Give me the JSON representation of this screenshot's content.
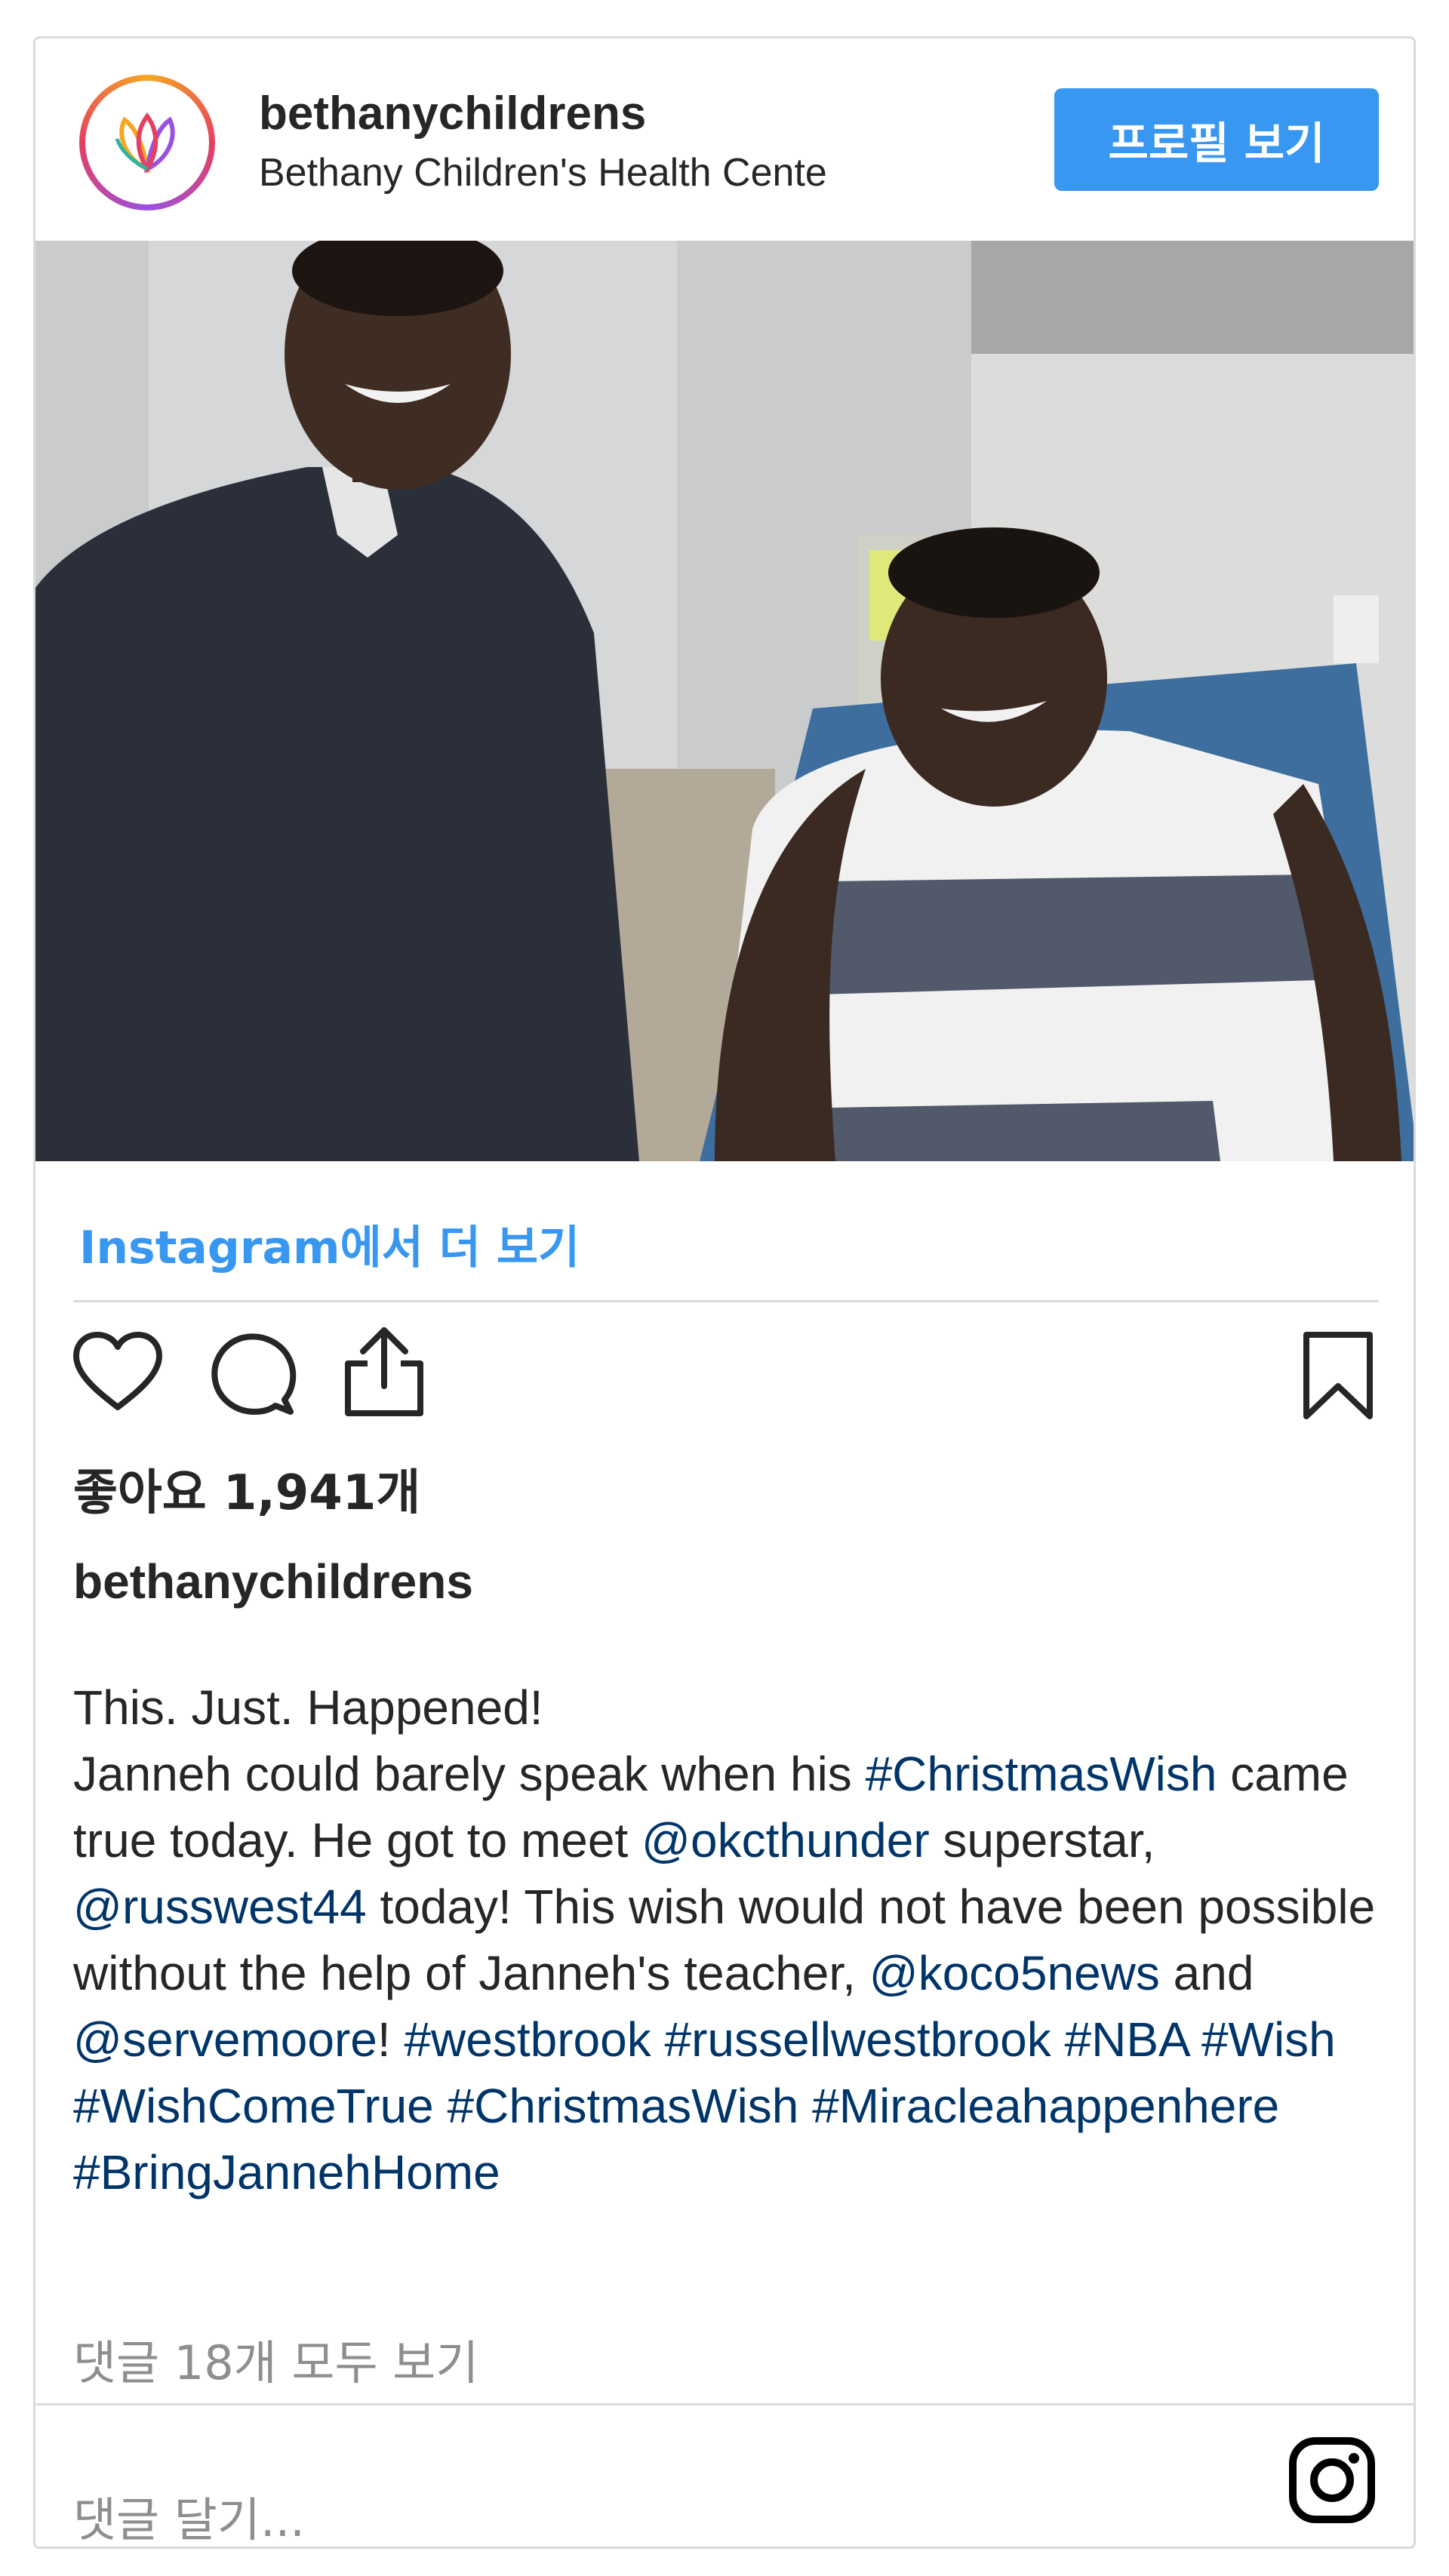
{
  "header": {
    "username": "bethanychildrens",
    "full_name": "Bethany Children's Health Cente",
    "profile_button": "프로필 보기"
  },
  "photo": {
    "icon": "post-photo"
  },
  "see_more": "Instagram에서 더 보기",
  "actions": {
    "like_icon": "heart-icon",
    "comment_icon": "comment-icon",
    "share_icon": "share-icon",
    "save_icon": "bookmark-icon"
  },
  "likes": "좋아요 1,941개",
  "caption": {
    "username": "bethanychildrens",
    "line1": "This. Just. Happened!",
    "seg1": "Janneh could barely speak when his ",
    "tag1": "#ChristmasWish",
    "seg2": " came true today. He got to meet ",
    "tag2": "@okcthunder",
    "seg3": " superstar, ",
    "tag3": "@russwest44",
    "seg4": " today! This wish would not have been possible without the help of Janneh's teacher, ",
    "tag4": "@koco5news",
    "seg5": " and ",
    "tag5": "@servemoore",
    "seg6": "! ",
    "tag6": "#westbrook",
    "tag7": "#russellwestbrook",
    "tag8": "#NBA",
    "tag9": "#Wish",
    "tag10": "#WishComeTrue",
    "tag11": "#ChristmasWish",
    "tag12": "#Miracleahappenhere",
    "tag13": "#BringJannehHome"
  },
  "view_comments": "댓글 18개 모두 보기",
  "add_comment_placeholder": "댓글 달기...",
  "colors": {
    "accent": "#3897f0",
    "hashtag": "#003569",
    "muted": "#8e8e8e"
  }
}
